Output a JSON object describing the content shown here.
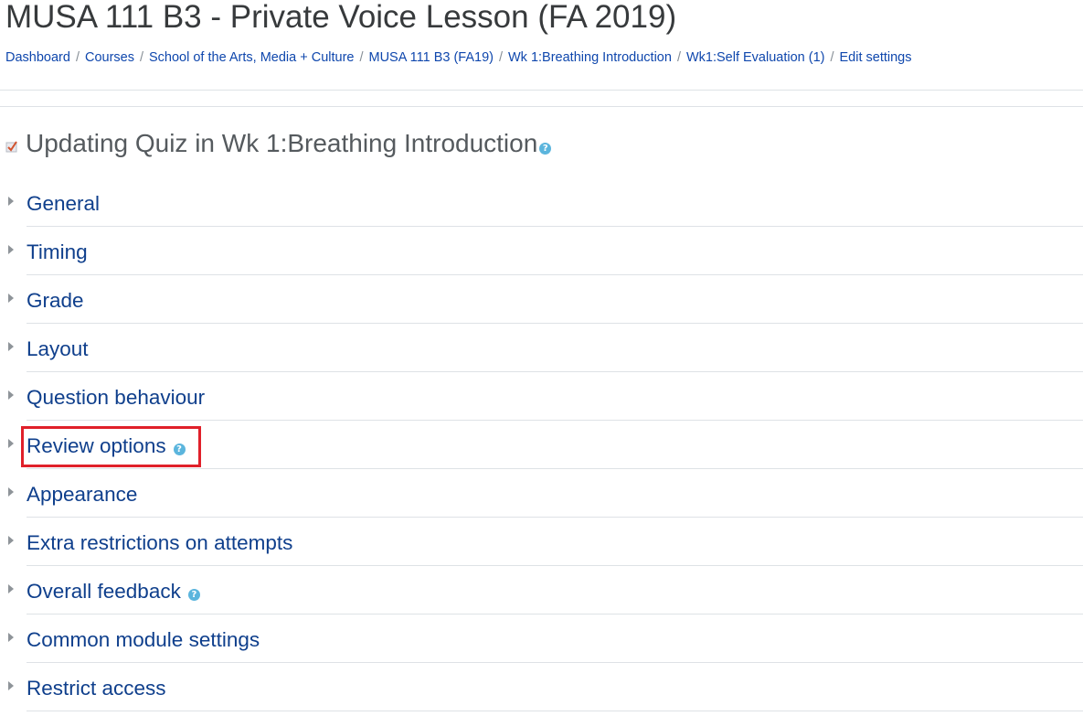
{
  "course": {
    "title": "MUSA 111 B3 - Private Voice Lesson (FA 2019)"
  },
  "breadcrumb": [
    {
      "label": "Dashboard"
    },
    {
      "label": "Courses"
    },
    {
      "label": "School of the Arts, Media + Culture"
    },
    {
      "label": "MUSA 111 B3 (FA19)"
    },
    {
      "label": "Wk 1:Breathing Introduction"
    },
    {
      "label": "Wk1:Self Evaluation (1)"
    },
    {
      "label": "Edit settings"
    }
  ],
  "breadcrumb_separator": "/",
  "page": {
    "heading": "Updating Quiz in Wk 1:Breathing Introduction",
    "icon": "quiz-icon",
    "help_icon": "question-circle-icon"
  },
  "sections": [
    {
      "label": "General",
      "has_help": false
    },
    {
      "label": "Timing",
      "has_help": false
    },
    {
      "label": "Grade",
      "has_help": false
    },
    {
      "label": "Layout",
      "has_help": false
    },
    {
      "label": "Question behaviour",
      "has_help": false
    },
    {
      "label": "Review options",
      "has_help": true,
      "highlighted": true
    },
    {
      "label": "Appearance",
      "has_help": false
    },
    {
      "label": "Extra restrictions on attempts",
      "has_help": false
    },
    {
      "label": "Overall feedback",
      "has_help": true
    },
    {
      "label": "Common module settings",
      "has_help": false
    },
    {
      "label": "Restrict access",
      "has_help": false
    }
  ],
  "help_glyph": "?",
  "colors": {
    "link": "#0f3f8c",
    "breadcrumb_link": "#0f47ad",
    "help_icon": "#5bb5dd",
    "highlight": "#e0202a"
  }
}
